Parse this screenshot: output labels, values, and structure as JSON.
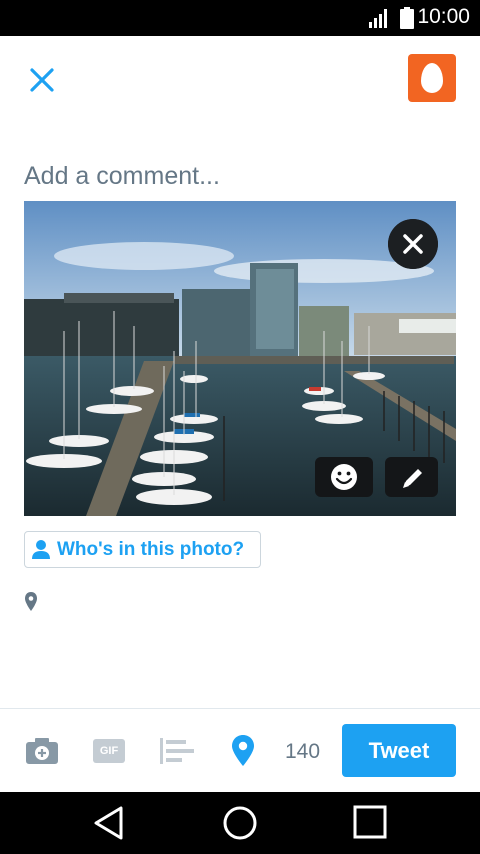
{
  "status_bar": {
    "time": "10:00"
  },
  "composer": {
    "comment_placeholder": "Add a comment...",
    "tag_people_label": "Who's in this photo?"
  },
  "toolbar": {
    "gif_label": "GIF",
    "char_count": "140",
    "tweet_label": "Tweet"
  },
  "colors": {
    "accent": "#1da1f2",
    "avatar_bg": "#f26522",
    "muted": "#657786",
    "icon_gray": "#c4ccd3"
  },
  "icons": {
    "close": "close-icon",
    "avatar": "egg-avatar",
    "remove_photo": "close-circle-icon",
    "sticker": "smiley-icon",
    "edit": "pencil-icon",
    "tag": "person-icon",
    "location": "map-pin-icon",
    "camera": "camera-icon",
    "poll": "poll-icon",
    "nav_back": "triangle-back-icon",
    "nav_home": "circle-home-icon",
    "nav_recent": "square-recent-icon"
  }
}
